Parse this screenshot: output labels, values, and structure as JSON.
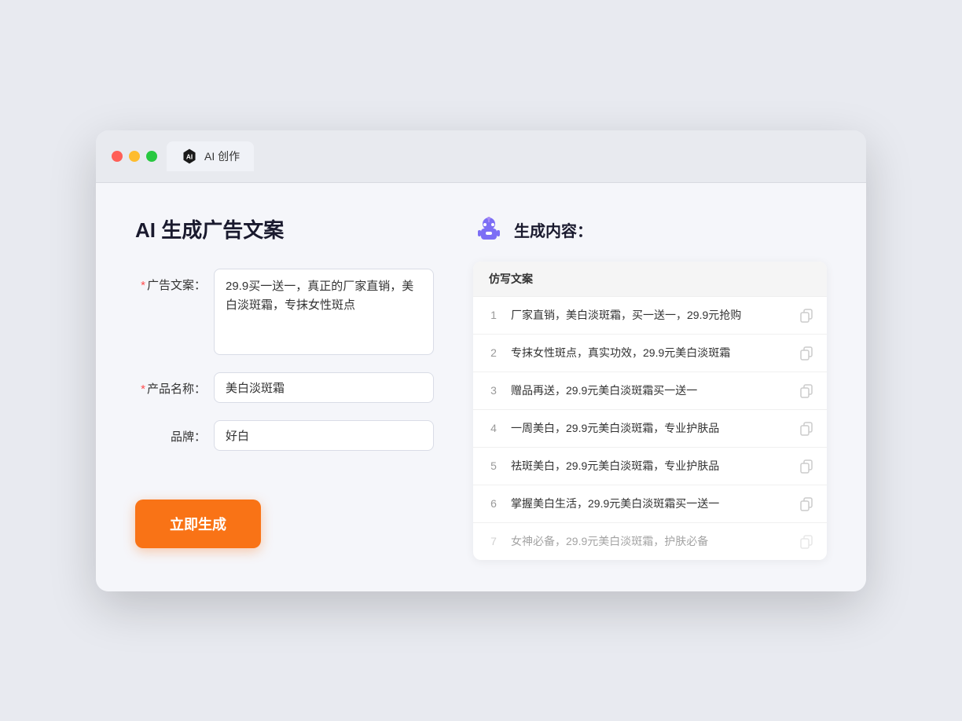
{
  "window": {
    "tab_label": "AI 创作"
  },
  "left": {
    "title": "AI 生成广告文案",
    "fields": [
      {
        "label": "广告文案：",
        "required": true,
        "type": "textarea",
        "value": "29.9买一送一，真正的厂家直销，美白淡斑霜，专抹女性斑点",
        "name": "ad-copy-input"
      },
      {
        "label": "产品名称：",
        "required": true,
        "type": "input",
        "value": "美白淡斑霜",
        "name": "product-name-input"
      },
      {
        "label": "品牌：",
        "required": false,
        "type": "input",
        "value": "好白",
        "name": "brand-input"
      }
    ],
    "button_label": "立即生成"
  },
  "right": {
    "title": "生成内容：",
    "table_header": "仿写文案",
    "rows": [
      {
        "number": "1",
        "text": "厂家直销，美白淡斑霜，买一送一，29.9元抢购",
        "dimmed": false
      },
      {
        "number": "2",
        "text": "专抹女性斑点，真实功效，29.9元美白淡斑霜",
        "dimmed": false
      },
      {
        "number": "3",
        "text": "赠品再送，29.9元美白淡斑霜买一送一",
        "dimmed": false
      },
      {
        "number": "4",
        "text": "一周美白，29.9元美白淡斑霜，专业护肤品",
        "dimmed": false
      },
      {
        "number": "5",
        "text": "祛斑美白，29.9元美白淡斑霜，专业护肤品",
        "dimmed": false
      },
      {
        "number": "6",
        "text": "掌握美白生活，29.9元美白淡斑霜买一送一",
        "dimmed": false
      },
      {
        "number": "7",
        "text": "女神必备，29.9元美白淡斑霜，护肤必备",
        "dimmed": true
      }
    ]
  },
  "colors": {
    "accent": "#f97316",
    "primary": "#7c6ef5",
    "required": "#ff4d4f"
  }
}
